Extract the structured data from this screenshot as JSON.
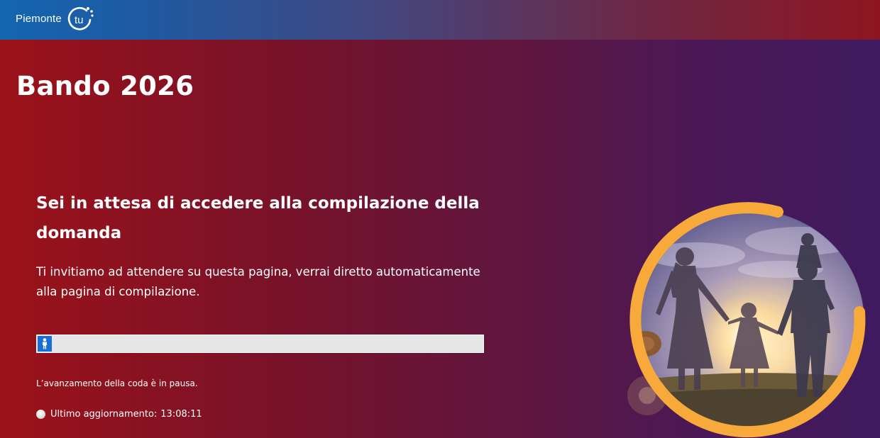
{
  "header": {
    "logo_text": "Piemonte",
    "logo_mark_text": "tu"
  },
  "page_title": "Bando 2026",
  "waiting": {
    "heading": "Sei in attesa di accedere alla compilazione della domanda",
    "description": "Ti invitiamo ad attendere su questa pagina, verrai diretto automaticamente alla pagina di compilazione.",
    "progress_fraction": 0.0,
    "queue_status": "L’avanzamento della coda è in pausa.",
    "last_update_label": "Ultimo aggiornamento:",
    "last_update_time": "13:08:11"
  },
  "icons": {
    "progress_icon": "person-icon",
    "status_icon": "status-dot-icon",
    "logo_icon": "piemonte-tu-logo"
  },
  "colors": {
    "topbar_left": "#1466b0",
    "topbar_right": "#8e1520",
    "bg_left": "#9b1219",
    "bg_right": "#3f1a60",
    "progress_accent": "#1a6fd6",
    "ring_orange": "#f7a93a"
  }
}
